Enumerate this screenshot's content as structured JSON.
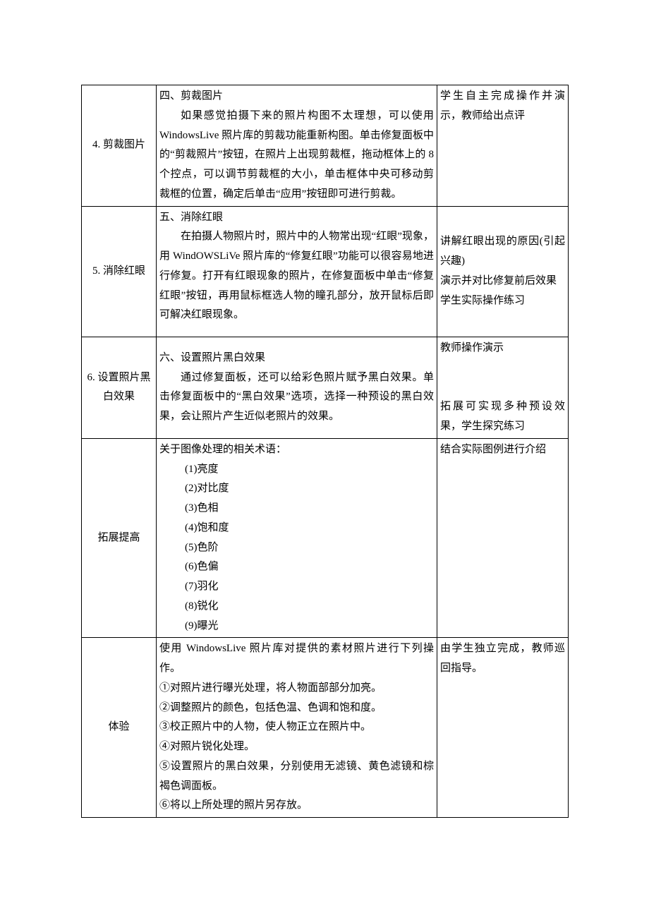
{
  "rows": [
    {
      "label": "4. 剪裁图片",
      "content": {
        "heading": "四、剪裁图片",
        "body": "如果感觉拍摄下来的照片构图不太理想，可以使用 WindowsLive 照片库的剪裁功能重新构图。单击修复面板中的“剪裁照片”按钮，在照片上出现剪裁框，拖动框体上的 8 个控点，可以调节剪裁框的大小，单击框体中央可移动剪裁框的位置，确定后单击“应用”按钮即可进行剪裁。"
      },
      "note": "学生自主完成操作并演示，教师给出点评"
    },
    {
      "label": "5. 消除红眼",
      "content": {
        "heading": "五、消除红眼",
        "body": "在拍摄人物照片时，照片中的人物常出现“红眼”现象，用 WindOWSLiVe 照片库的“修复红眼”功能可以很容易地进行修复。打开有红眼现象的照片，在修复面板中单击“修复红眼”按钮，再用鼠标框选人物的瞳孔部分，放开鼠标后即可解决红眼现象。"
      },
      "note": "讲解红眼出现的原因(引起兴趣)\n演示并对比修复前后效果\n学生实际操作练习"
    },
    {
      "label": "6. 设置照片黑白效果",
      "content": {
        "heading": "六、设置照片黑白效果",
        "body": "通过修复面板，还可以给彩色照片赋予黑白效果。单击修复面板中的“黑白效果”选项，选择一种预设的黑白效果，会让照片产生近似老照片的效果。"
      },
      "note": "教师操作演示\n\n\n拓展可实现多种预设效果，学生探究练习"
    },
    {
      "label": "拓展提高",
      "content": {
        "heading": "关于图像处理的相关术语：",
        "items": [
          "(1)亮度",
          "(2)对比度",
          "(3)色相",
          "(4)饱和度",
          "(5)色阶",
          "(6)色偏",
          "(7)羽化",
          "(8)锐化",
          "(9)曝光"
        ]
      },
      "note": "结合实际图例进行介绍"
    },
    {
      "label": "体验",
      "content": {
        "lines": [
          "使用 WindowsLive 照片库对提供的素材照片进行下列操作。",
          "①对照片进行曝光处理，将人物面部部分加亮。",
          "②调整照片的颜色，包括色温、色调和饱和度。",
          "③校正照片中的人物，使人物正立在照片中。",
          "④对照片锐化处理。",
          "⑤设置照片的黑白效果，分别使用无滤镜、黄色滤镜和棕褐色调面板。",
          "⑥将以上所处理的照片另存放。"
        ]
      },
      "note": "由学生独立完成，教师巡回指导。"
    }
  ]
}
